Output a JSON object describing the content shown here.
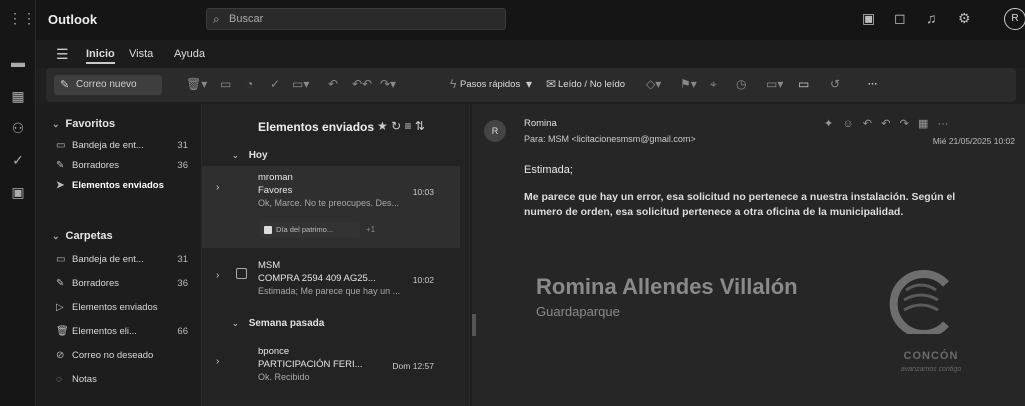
{
  "app": {
    "brand": "Outlook",
    "search_placeholder": "Buscar",
    "avatar_initial": "R"
  },
  "ribbon": {
    "tabs": [
      "Inicio",
      "Vista",
      "Ayuda"
    ],
    "new_mail": "Correo nuevo",
    "quick_steps": "Pasos rápidos",
    "read_unread": "Leído / No leído",
    "more": "···"
  },
  "folders": {
    "favorites_header": "Favoritos",
    "favorites": [
      {
        "label": "Bandeja de ent...",
        "count": "31"
      },
      {
        "label": "Borradores",
        "count": "36"
      },
      {
        "label": "Elementos enviados",
        "count": ""
      }
    ],
    "folders_header": "Carpetas",
    "folders": [
      {
        "label": "Bandeja de ent...",
        "count": "31"
      },
      {
        "label": "Borradores",
        "count": "36"
      },
      {
        "label": "Elementos enviados",
        "count": ""
      },
      {
        "label": "Elementos eli...",
        "count": "66"
      },
      {
        "label": "Correo no deseado",
        "count": ""
      },
      {
        "label": "Notas",
        "count": ""
      }
    ]
  },
  "list": {
    "header": "Elementos enviados",
    "group_today": "Hoy",
    "group_last_week": "Semana pasada",
    "messages": [
      {
        "from": "mroman",
        "subject": "Favores",
        "time": "10:03",
        "preview": "Ok, Marce. No te preocupes. Des..."
      },
      {
        "from": "MSM",
        "subject": "COMPRA 2594 409 AG25...",
        "time": "10:02",
        "preview": "Estimada; Me parece que hay un ..."
      },
      {
        "from": "bponce",
        "subject": "PARTICIPACIÓN FERI...",
        "time": "Dom 12:57",
        "preview": "Ok. Recibido"
      }
    ],
    "chip_label": "Día del patrimo...",
    "chip_extra": "+1"
  },
  "reading": {
    "avatar_initial": "R",
    "sender": "Romina",
    "to": "Para:  MSM <licitacionesmsm@gmail.com>",
    "date": "Mié 21/05/2025 10:02",
    "greeting": "Estimada;",
    "body": "Me parece que hay un error, esa solicitud no pertenece a nuestra instalación. Según el numero de orden, esa solicitud pertenece a otra oficina de la municipalidad.",
    "signature_name": "Romina Allendes Villalón",
    "signature_role": "Guardaparque",
    "logo_text": "CONCÓN",
    "logo_sub": "avanzamos contigo"
  }
}
